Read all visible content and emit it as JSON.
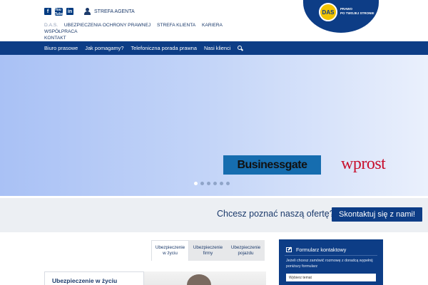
{
  "header": {
    "social": [
      {
        "icon": "facebook-icon",
        "glyph": "f"
      },
      {
        "icon": "youtube-icon",
        "glyph": "You Tube"
      },
      {
        "icon": "linkedin-icon",
        "glyph": "in"
      }
    ],
    "agent_label": "STREFA AGENTA",
    "top_nav": [
      {
        "label": "D.A.S.",
        "muted": true
      },
      {
        "label": "UBEZPIECZENIA OCHRONY PRAWNEJ"
      },
      {
        "label": "STREFA KLIENTA"
      },
      {
        "label": "KARIERA"
      },
      {
        "label": "WSPÓŁPRACA"
      },
      {
        "label": "KONTAKT"
      }
    ],
    "logo": {
      "badge": "DAS",
      "tagline_1": "PRAWO",
      "tagline_2": "PO TWOJEJ STRONIE"
    }
  },
  "main_nav": {
    "items": [
      "Biuro prasowe",
      "Jak pomagamy?",
      "Telefoniczna porada prawna",
      "Nasi klienci"
    ]
  },
  "hero": {
    "logos": [
      "Businessgate",
      "wprost"
    ],
    "dots": 6,
    "active_dot": 0
  },
  "cta": {
    "text": "Chcesz poznać naszą ofertę?",
    "button": "Skontaktuj się z nami!"
  },
  "tabs": [
    {
      "label": "Ubezpieczenie w życiu",
      "active": true
    },
    {
      "label": "Ubezpieczenie firmy",
      "active": false
    },
    {
      "label": "Ubezpieczenie pojazdu",
      "active": false
    }
  ],
  "card": {
    "title": "Ubezpieczenie w życiu"
  },
  "contact_form": {
    "title": "Formularz kontaktowy",
    "description": "Jeżeli chcesz zamówić rozmowę z doradcą wypełnij poniższy formularz",
    "select_placeholder": "Wybierz temat"
  },
  "colors": {
    "brand_navy": "#0d3d86",
    "cta_bg": "#eceff3",
    "wprost_red": "#c8102e"
  }
}
